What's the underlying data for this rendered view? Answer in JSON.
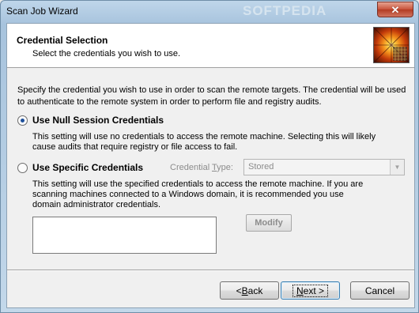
{
  "window": {
    "title": "Scan Job Wizard",
    "watermark": "SOFTPEDIA",
    "close_glyph": "✕"
  },
  "header": {
    "title": "Credential Selection",
    "subtitle": "Select the credentials you wish to use."
  },
  "description": "Specify the credential you wish to use in order to scan the remote targets.  The credential will be used to authenticate to the remote system in order to perform file and registry audits.",
  "options": {
    "null_session": {
      "label": "Use Null Session Credentials",
      "checked": true,
      "help": "This setting will use no credentials to access the remote machine.  Selecting this will likely cause audits that require registry or file access to fail."
    },
    "specific": {
      "label": "Use Specific Credentials",
      "checked": false,
      "help": "This setting will use the specified credentials to access the remote machine.  If you are scanning machines connected to a Windows domain, it is recommended you use domain administrator credentials."
    }
  },
  "credential_type": {
    "label_before": "Credential ",
    "label_mnemonic": "T",
    "label_after": "ype:",
    "value": "Stored"
  },
  "modify_button": "Modify",
  "buttons": {
    "back": {
      "prefix": "< ",
      "mnemonic": "B",
      "rest": "ack"
    },
    "next": {
      "mnemonic": "N",
      "rest": "ext >"
    },
    "cancel": "Cancel"
  }
}
